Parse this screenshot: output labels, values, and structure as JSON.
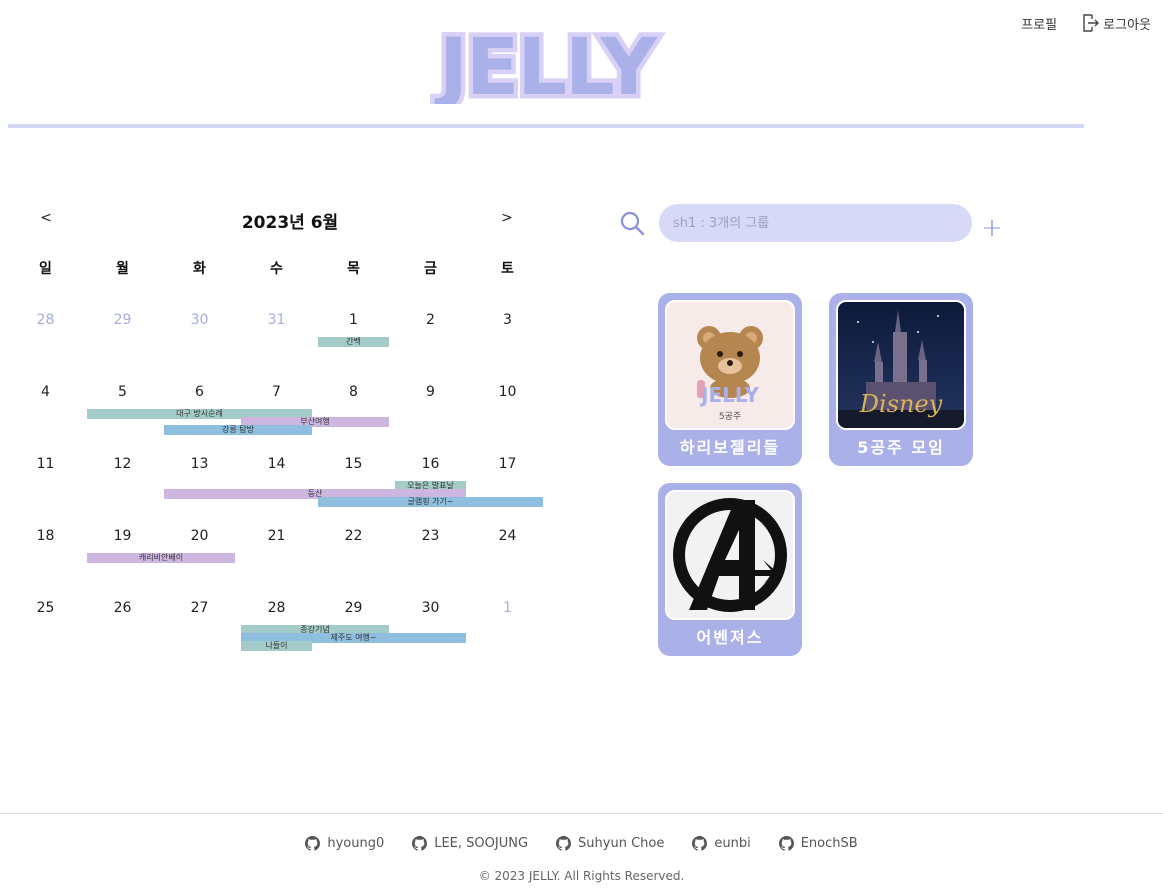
{
  "header": {
    "logo_text": "JELLY",
    "profile_label": "프로필",
    "logout_label": "로그아웃",
    "accent_color": "#d3d6f5",
    "logo_fill": "#aab0e8",
    "logo_outline": "#d8d0f5"
  },
  "calendar": {
    "prev_label": "<",
    "next_label": ">",
    "title": "2023년 6월",
    "weekdays": [
      "일",
      "월",
      "화",
      "수",
      "목",
      "금",
      "토"
    ],
    "weeks": [
      [
        {
          "d": "28",
          "muted": true
        },
        {
          "d": "29",
          "muted": true
        },
        {
          "d": "30",
          "muted": true
        },
        {
          "d": "31",
          "muted": true
        },
        {
          "d": "1"
        },
        {
          "d": "2"
        },
        {
          "d": "3"
        }
      ],
      [
        {
          "d": "4"
        },
        {
          "d": "5"
        },
        {
          "d": "6"
        },
        {
          "d": "7"
        },
        {
          "d": "8"
        },
        {
          "d": "9"
        },
        {
          "d": "10"
        }
      ],
      [
        {
          "d": "11"
        },
        {
          "d": "12"
        },
        {
          "d": "13"
        },
        {
          "d": "14"
        },
        {
          "d": "15"
        },
        {
          "d": "16"
        },
        {
          "d": "17"
        }
      ],
      [
        {
          "d": "18"
        },
        {
          "d": "19"
        },
        {
          "d": "20"
        },
        {
          "d": "21"
        },
        {
          "d": "22"
        },
        {
          "d": "23"
        },
        {
          "d": "24"
        }
      ],
      [
        {
          "d": "25"
        },
        {
          "d": "26"
        },
        {
          "d": "27"
        },
        {
          "d": "28"
        },
        {
          "d": "29"
        },
        {
          "d": "30"
        },
        {
          "d": "1",
          "muted": true
        }
      ]
    ],
    "events": [
      {
        "title": "간백",
        "week": 0,
        "start": 4,
        "end": 4,
        "color": "#a3cbc9"
      },
      {
        "title": "대구 방시순례",
        "week": 1,
        "start": 1,
        "end": 3,
        "color": "#a3cbc9"
      },
      {
        "title": "부산여행",
        "week": 1,
        "start": 3,
        "end": 4,
        "color": "#cdb6df"
      },
      {
        "title": "강릉 탐방",
        "week": 1,
        "start": 2,
        "end": 3,
        "color": "#8fbfdf"
      },
      {
        "title": "오늘은 발표날",
        "week": 2,
        "start": 5,
        "end": 5,
        "color": "#a3cbc9"
      },
      {
        "title": "등산",
        "week": 2,
        "start": 2,
        "end": 5,
        "color": "#cdb6df"
      },
      {
        "title": "글램핑 가기~",
        "week": 2,
        "start": 4,
        "end": 6,
        "color": "#8fbfdf"
      },
      {
        "title": "캐리비안베이",
        "week": 3,
        "start": 1,
        "end": 2,
        "color": "#cdb6df"
      },
      {
        "title": "종강기념",
        "week": 4,
        "start": 3,
        "end": 4,
        "color": "#a3cbc9"
      },
      {
        "title": "제주도 여행~",
        "week": 4,
        "start": 3,
        "end": 5,
        "color": "#8fbfdf"
      },
      {
        "title": "나들이",
        "week": 4,
        "start": 3,
        "end": 3,
        "color": "#a3cbc9"
      }
    ]
  },
  "search": {
    "placeholder": "sh1 : 3개의 그룹",
    "value": "",
    "add_label": "+"
  },
  "groups": [
    {
      "name": "하리보젤리들",
      "icon": "bear-jelly-image"
    },
    {
      "name": "5공주 모임",
      "icon": "disney-castle-image"
    },
    {
      "name": "어벤져스",
      "icon": "avengers-logo-image"
    }
  ],
  "footer": {
    "links": [
      "hyoung0",
      "LEE, SOOJUNG",
      "Suhyun Choe",
      "eunbi",
      "EnochSB"
    ],
    "copyright": "© 2023 JELLY. All Rights Reserved."
  }
}
